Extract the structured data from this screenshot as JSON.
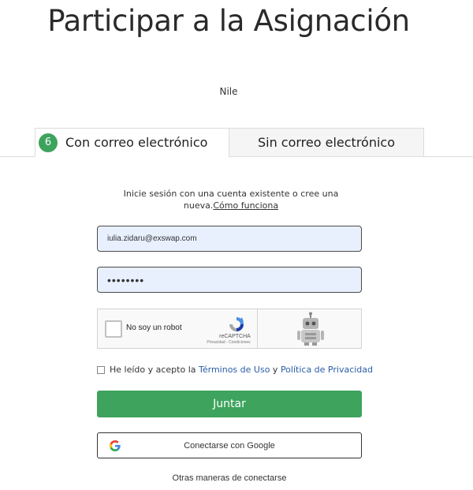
{
  "page": {
    "title": "Participar a la Asignación",
    "subtitle": "Nile"
  },
  "tabs": [
    {
      "badge": "6",
      "label": "Con correo electrónico",
      "active": true
    },
    {
      "label": "Sin correo electrónico",
      "active": false
    }
  ],
  "intro": {
    "text": "Inicie sesión con una cuenta existente o cree una nueva.",
    "link": "Cómo funciona"
  },
  "form": {
    "email_value": "iulia.zidaru@exswap.com",
    "password_value": "••••••••"
  },
  "captcha": {
    "label": "No soy un robot",
    "brand": "reCAPTCHA",
    "links": "Privacidad - Condiciones",
    "icons": [
      "recaptcha-logo-icon",
      "robot-icon"
    ]
  },
  "terms": {
    "prefix": "He leído y acepto la ",
    "terms_link": "Términos de Uso",
    "connector": " y ",
    "privacy_link": "Política de Privacidad"
  },
  "buttons": {
    "join": "Juntar",
    "google": "Conectarse con Google",
    "other": "Otras maneras de conectarse"
  },
  "colors": {
    "accent_green": "#3da35d",
    "link_blue": "#2a5ca8",
    "input_bg": "#e8f0fe"
  }
}
